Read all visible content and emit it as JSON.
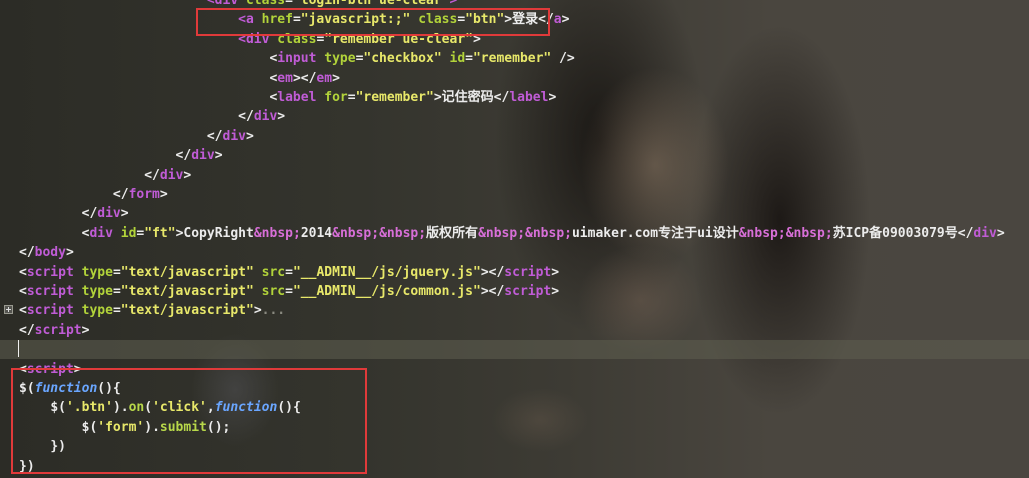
{
  "editor": {
    "lines": [
      {
        "indent": "                        ",
        "parts": [
          [
            "tag",
            "<div "
          ],
          [
            "attr",
            "class"
          ],
          [
            "plain",
            "="
          ],
          [
            "str",
            "\"login-btn ue-clear\""
          ],
          [
            "tag",
            ">"
          ]
        ]
      },
      {
        "indent": "                            ",
        "parts": [
          [
            "tag",
            "<a "
          ],
          [
            "attr",
            "href"
          ],
          [
            "plain",
            "="
          ],
          [
            "str",
            "\"javascript:;\""
          ],
          [
            "plain",
            " "
          ],
          [
            "attr",
            "class"
          ],
          [
            "plain",
            "="
          ],
          [
            "str",
            "\"btn\""
          ],
          [
            "plain",
            ">登录</"
          ],
          [
            "tag",
            "a"
          ],
          [
            "plain",
            ">"
          ]
        ]
      },
      {
        "indent": "                            ",
        "parts": [
          [
            "tag",
            "<div "
          ],
          [
            "attr",
            "class"
          ],
          [
            "plain",
            "="
          ],
          [
            "str",
            "\"remember ue-clear\""
          ],
          [
            "plain",
            ">"
          ]
        ]
      },
      {
        "indent": "                                ",
        "parts": [
          [
            "plain",
            "<"
          ],
          [
            "tag",
            "input "
          ],
          [
            "attr",
            "type"
          ],
          [
            "plain",
            "="
          ],
          [
            "str",
            "\"checkbox\""
          ],
          [
            "plain",
            " "
          ],
          [
            "attr",
            "id"
          ],
          [
            "plain",
            "="
          ],
          [
            "str",
            "\"remember\""
          ],
          [
            "plain",
            " />"
          ]
        ]
      },
      {
        "indent": "                                ",
        "parts": [
          [
            "plain",
            "<"
          ],
          [
            "tag",
            "em"
          ],
          [
            "plain",
            "></"
          ],
          [
            "tag",
            "em"
          ],
          [
            "plain",
            ">"
          ]
        ]
      },
      {
        "indent": "                                ",
        "parts": [
          [
            "plain",
            "<"
          ],
          [
            "tag",
            "label "
          ],
          [
            "attr",
            "for"
          ],
          [
            "plain",
            "="
          ],
          [
            "str",
            "\"remember\""
          ],
          [
            "plain",
            ">记住密码</"
          ],
          [
            "tag",
            "label"
          ],
          [
            "plain",
            ">"
          ]
        ]
      },
      {
        "indent": "                            ",
        "parts": [
          [
            "plain",
            "</"
          ],
          [
            "tag",
            "div"
          ],
          [
            "plain",
            ">"
          ]
        ]
      },
      {
        "indent": "                        ",
        "parts": [
          [
            "plain",
            "</"
          ],
          [
            "tag",
            "div"
          ],
          [
            "plain",
            ">"
          ]
        ]
      },
      {
        "indent": "                    ",
        "parts": [
          [
            "plain",
            "</"
          ],
          [
            "tag",
            "div"
          ],
          [
            "plain",
            ">"
          ]
        ]
      },
      {
        "indent": "                ",
        "parts": [
          [
            "plain",
            "</"
          ],
          [
            "tag",
            "div"
          ],
          [
            "plain",
            ">"
          ]
        ]
      },
      {
        "indent": "            ",
        "parts": [
          [
            "plain",
            "</"
          ],
          [
            "tag",
            "form"
          ],
          [
            "plain",
            ">"
          ]
        ]
      },
      {
        "indent": "        ",
        "parts": [
          [
            "plain",
            "</"
          ],
          [
            "tag",
            "div"
          ],
          [
            "plain",
            ">"
          ]
        ]
      },
      {
        "indent": "        ",
        "parts": [
          [
            "plain",
            "<"
          ],
          [
            "tag",
            "div "
          ],
          [
            "attr",
            "id"
          ],
          [
            "plain",
            "="
          ],
          [
            "str",
            "\"ft\""
          ],
          [
            "plain",
            ">CopyRight"
          ],
          [
            "ent",
            "&nbsp;"
          ],
          [
            "plain",
            "2014"
          ],
          [
            "ent",
            "&nbsp;&nbsp;"
          ],
          [
            "plain",
            "版权所有"
          ],
          [
            "ent",
            "&nbsp;&nbsp;"
          ],
          [
            "plain",
            "uimaker.com专注于ui设计"
          ],
          [
            "ent",
            "&nbsp;&nbsp;"
          ],
          [
            "plain",
            "苏ICP备09003079号</"
          ],
          [
            "tag",
            "div"
          ],
          [
            "plain",
            ">"
          ]
        ]
      },
      {
        "indent": "",
        "parts": [
          [
            "plain",
            "</"
          ],
          [
            "tag",
            "body"
          ],
          [
            "plain",
            ">"
          ]
        ]
      },
      {
        "indent": "",
        "parts": [
          [
            "plain",
            "<"
          ],
          [
            "tag",
            "script "
          ],
          [
            "attr",
            "type"
          ],
          [
            "plain",
            "="
          ],
          [
            "str",
            "\"text/javascript\""
          ],
          [
            "plain",
            " "
          ],
          [
            "attr",
            "src"
          ],
          [
            "plain",
            "="
          ],
          [
            "str",
            "\"__ADMIN__/js/jquery.js\""
          ],
          [
            "plain",
            "></"
          ],
          [
            "tag",
            "script"
          ],
          [
            "plain",
            ">"
          ]
        ]
      },
      {
        "indent": "",
        "parts": [
          [
            "plain",
            "<"
          ],
          [
            "tag",
            "script "
          ],
          [
            "attr",
            "type"
          ],
          [
            "plain",
            "="
          ],
          [
            "str",
            "\"text/javascript\""
          ],
          [
            "plain",
            " "
          ],
          [
            "attr",
            "src"
          ],
          [
            "plain",
            "="
          ],
          [
            "str",
            "\"__ADMIN__/js/common.js\""
          ],
          [
            "plain",
            "></"
          ],
          [
            "tag",
            "script"
          ],
          [
            "plain",
            ">"
          ]
        ]
      },
      {
        "indent": "",
        "parts": [
          [
            "plain",
            "<"
          ],
          [
            "tag",
            "script "
          ],
          [
            "attr",
            "type"
          ],
          [
            "plain",
            "="
          ],
          [
            "str",
            "\"text/javascript\""
          ],
          [
            "plain",
            ">"
          ],
          [
            "fold",
            "..."
          ]
        ]
      },
      {
        "indent": "",
        "parts": [
          [
            "plain",
            "</"
          ],
          [
            "tag",
            "script"
          ],
          [
            "plain",
            ">"
          ]
        ]
      },
      {
        "indent": "",
        "parts": [
          [
            "plain",
            ""
          ]
        ],
        "active": true
      },
      {
        "indent": "",
        "parts": [
          [
            "plain",
            "<"
          ],
          [
            "tag",
            "script"
          ],
          [
            "plain",
            ">"
          ]
        ]
      },
      {
        "indent": "",
        "parts": [
          [
            "plain",
            "$("
          ],
          [
            "kw",
            "function"
          ],
          [
            "plain",
            "(){"
          ]
        ]
      },
      {
        "indent": "    ",
        "parts": [
          [
            "plain",
            "$("
          ],
          [
            "str",
            "'.btn'"
          ],
          [
            "plain",
            ")."
          ],
          [
            "method",
            "on"
          ],
          [
            "plain",
            "("
          ],
          [
            "str",
            "'click'"
          ],
          [
            "plain",
            ","
          ],
          [
            "kw",
            "function"
          ],
          [
            "plain",
            "(){"
          ]
        ]
      },
      {
        "indent": "        ",
        "parts": [
          [
            "plain",
            "$("
          ],
          [
            "str",
            "'form'"
          ],
          [
            "plain",
            ")."
          ],
          [
            "method",
            "submit"
          ],
          [
            "plain",
            "();"
          ]
        ]
      },
      {
        "indent": "    ",
        "parts": [
          [
            "plain",
            "})"
          ]
        ]
      },
      {
        "indent": "",
        "parts": [
          [
            "plain",
            "})"
          ]
        ]
      }
    ]
  },
  "colors": {
    "highlight_box": "#e03a3a",
    "tag": "#c05cd6",
    "attribute": "#b2d33a",
    "string": "#e8e86a",
    "keyword": "#6aa6ff"
  },
  "icons": {
    "fold_toggle": "plus-box-icon"
  }
}
